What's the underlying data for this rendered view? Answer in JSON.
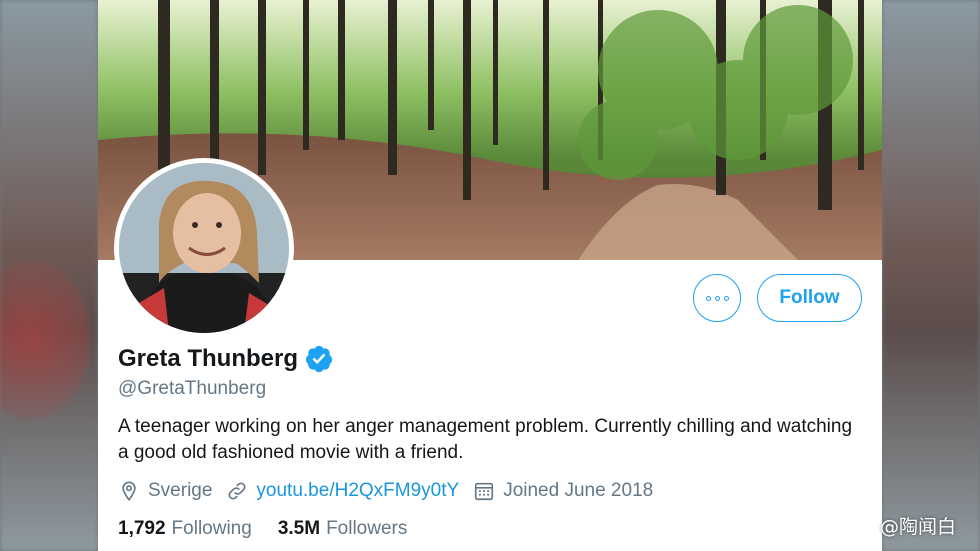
{
  "profile": {
    "name": "Greta Thunberg",
    "handle": "@GretaThunberg",
    "verified_icon": "verified-badge-icon",
    "bio": "A teenager working on her anger management problem. Currently chilling and watching a good old fashioned movie with a friend.",
    "location": "Sverige",
    "website": "youtu.be/H2QxFM9y0tY",
    "joined": "Joined June 2018"
  },
  "actions": {
    "more_icon": "more-options-icon",
    "follow_label": "Follow"
  },
  "stats": {
    "following_count": "1,792",
    "following_label": "Following",
    "followers_count": "3.5M",
    "followers_label": "Followers"
  },
  "colors": {
    "accent": "#1da1f2",
    "link": "#1b95e0",
    "text_primary": "#14171a",
    "text_secondary": "#657786"
  },
  "watermark": "@陶闻白"
}
